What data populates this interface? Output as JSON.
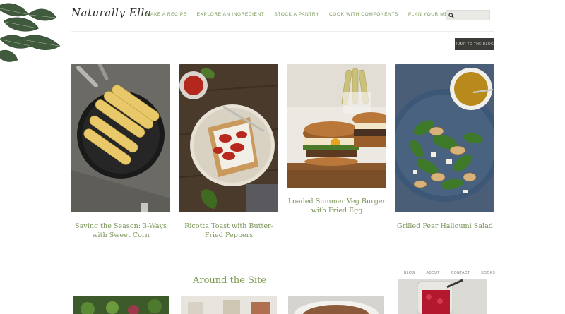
{
  "site": {
    "logo_text": "Naturally Ella"
  },
  "nav": {
    "items": [
      "MAKE A RECIPE",
      "EXPLORE AN INGREDIENT",
      "STOCK A PANTRY",
      "COOK WITH COMPONENTS",
      "PLAN YOUR MEALS"
    ]
  },
  "search": {
    "value": "",
    "placeholder": ""
  },
  "jump_button": {
    "label": "JUMP TO THE BLOG"
  },
  "recipes": [
    {
      "title": "Saving the Season: 3-Ways with Sweet Corn"
    },
    {
      "title": "Ricotta Toast with Butter-Fried Peppers"
    },
    {
      "title": "Loaded Summer Veg Burger with Fried Egg"
    },
    {
      "title": "Grilled Pear Halloumi Salad"
    }
  ],
  "around": {
    "heading": "Around the Site"
  },
  "footer_links": [
    "BLOG",
    "ABOUT",
    "CONTACT",
    "BOOKS"
  ],
  "colors": {
    "accent_green": "#7a9358",
    "dark_button": "#3b3b38"
  }
}
